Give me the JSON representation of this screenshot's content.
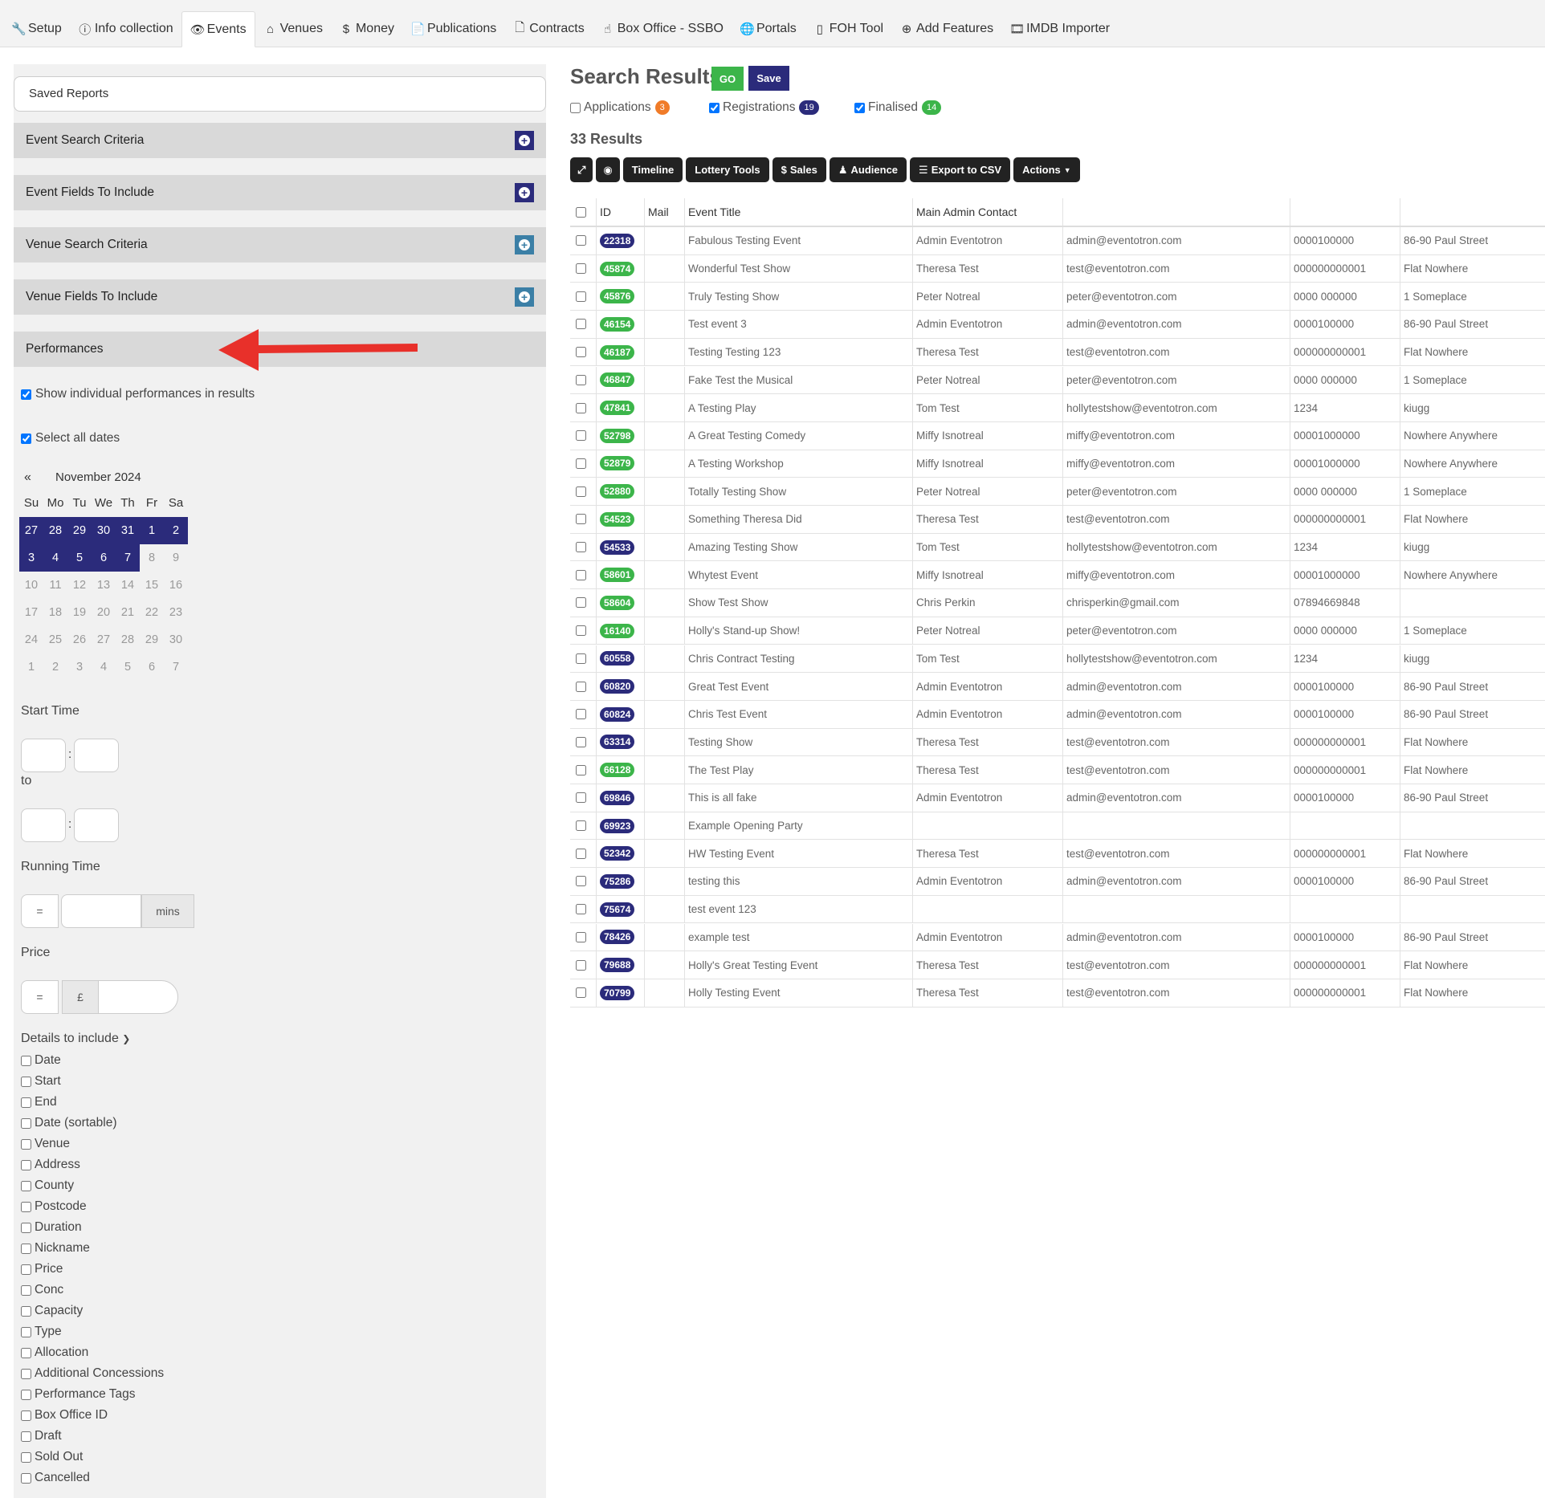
{
  "nav": {
    "tabs": [
      {
        "label": "Setup",
        "icon": "wrench-icon"
      },
      {
        "label": "Info collection",
        "icon": "info-icon"
      },
      {
        "label": "Events",
        "icon": "eye-icon"
      },
      {
        "label": "Venues",
        "icon": "home-icon"
      },
      {
        "label": "Money",
        "icon": "dollar-icon"
      },
      {
        "label": "Publications",
        "icon": "documents-icon"
      },
      {
        "label": "Contracts",
        "icon": "file-icon"
      },
      {
        "label": "Box Office - SSBO",
        "icon": "hand-icon"
      },
      {
        "label": "Portals",
        "icon": "globe-icon"
      },
      {
        "label": "FOH Tool",
        "icon": "mobile-icon"
      },
      {
        "label": "Add Features",
        "icon": "plus-circle-icon"
      },
      {
        "label": "IMDB Importer",
        "icon": "film-icon"
      }
    ],
    "active": "Events"
  },
  "sidebar": {
    "saved_reports": "Saved Reports",
    "panels": [
      "Event Search Criteria",
      "Event Fields To Include",
      "Venue Search Criteria",
      "Venue Fields To Include"
    ],
    "performances_label": "Performances",
    "show_individual": "Show individual performances in results",
    "select_all_dates": "Select all dates",
    "calendar": {
      "prev": "«",
      "month": "November 2024",
      "days_of_week": [
        "Su",
        "Mo",
        "Tu",
        "We",
        "Th",
        "Fr",
        "Sa"
      ],
      "weeks": [
        [
          "27",
          "28",
          "29",
          "30",
          "31",
          "1",
          "2"
        ],
        [
          "3",
          "4",
          "5",
          "6",
          "7",
          "8",
          "9"
        ],
        [
          "10",
          "11",
          "12",
          "13",
          "14",
          "15",
          "16"
        ],
        [
          "17",
          "18",
          "19",
          "20",
          "21",
          "22",
          "23"
        ],
        [
          "24",
          "25",
          "26",
          "27",
          "28",
          "29",
          "30"
        ],
        [
          "1",
          "2",
          "3",
          "4",
          "5",
          "6",
          "7"
        ]
      ],
      "selected_count": 12
    },
    "start_time_label": "Start Time",
    "to_label": "to",
    "colon": ":",
    "running_time_label": "Running Time",
    "eq": "=",
    "mins": "mins",
    "price_label": "Price",
    "currency": "£",
    "details_label": "Details to include",
    "details": [
      "Date",
      "Start",
      "End",
      "Date (sortable)",
      "Venue",
      "Address",
      "County",
      "Postcode",
      "Duration",
      "Nickname",
      "Price",
      "Conc",
      "Capacity",
      "Type",
      "Allocation",
      "Additional Concessions",
      "Performance Tags",
      "Box Office ID",
      "Draft",
      "Sold Out",
      "Cancelled"
    ]
  },
  "main": {
    "title": "Search Results",
    "go_label": "GO",
    "save_label": "Save",
    "filters": [
      {
        "label": "Applications",
        "count": "3",
        "checked": false,
        "color": "orange"
      },
      {
        "label": "Registrations",
        "count": "19",
        "checked": true,
        "color": "navy"
      },
      {
        "label": "Finalised",
        "count": "14",
        "checked": true,
        "color": "green"
      }
    ],
    "results_count": "33 Results",
    "toolbar": [
      "Timeline",
      "Lottery Tools",
      "Sales",
      "Audience",
      "Export to CSV",
      "Actions"
    ],
    "columns": [
      "ID",
      "Mail",
      "Event Title",
      "Main Admin Contact"
    ],
    "rows": [
      {
        "id": "22318",
        "status": "navy",
        "title": "Fabulous Testing Event",
        "contact": "Admin Eventotron",
        "email": "admin@eventotron.com",
        "phone": "0000100000",
        "address": "86-90 Paul Street"
      },
      {
        "id": "45874",
        "status": "green",
        "title": "Wonderful Test Show",
        "contact": "Theresa Test",
        "email": "test@eventotron.com",
        "phone": "000000000001",
        "address": "Flat Nowhere"
      },
      {
        "id": "45876",
        "status": "green",
        "title": "Truly Testing Show",
        "contact": "Peter Notreal",
        "email": "peter@eventotron.com",
        "phone": "0000 000000",
        "address": "1 Someplace"
      },
      {
        "id": "46154",
        "status": "green",
        "title": "Test event 3",
        "contact": "Admin Eventotron",
        "email": "admin@eventotron.com",
        "phone": "0000100000",
        "address": "86-90 Paul Street"
      },
      {
        "id": "46187",
        "status": "green",
        "title": "Testing Testing 123",
        "contact": "Theresa Test",
        "email": "test@eventotron.com",
        "phone": "000000000001",
        "address": "Flat Nowhere"
      },
      {
        "id": "46847",
        "status": "green",
        "title": "Fake Test the Musical",
        "contact": "Peter Notreal",
        "email": "peter@eventotron.com",
        "phone": "0000 000000",
        "address": "1 Someplace"
      },
      {
        "id": "47841",
        "status": "green",
        "title": "A Testing Play",
        "contact": "Tom Test",
        "email": "hollytestshow@eventotron.com",
        "phone": "1234",
        "address": "kiugg"
      },
      {
        "id": "52798",
        "status": "green",
        "title": "A Great Testing Comedy",
        "contact": "Miffy Isnotreal",
        "email": "miffy@eventotron.com",
        "phone": "00001000000",
        "address": "Nowhere Anywhere"
      },
      {
        "id": "52879",
        "status": "green",
        "title": "A Testing Workshop",
        "contact": "Miffy Isnotreal",
        "email": "miffy@eventotron.com",
        "phone": "00001000000",
        "address": "Nowhere Anywhere"
      },
      {
        "id": "52880",
        "status": "green",
        "title": "Totally Testing Show",
        "contact": "Peter Notreal",
        "email": "peter@eventotron.com",
        "phone": "0000 000000",
        "address": "1 Someplace"
      },
      {
        "id": "54523",
        "status": "green",
        "title": "Something Theresa Did",
        "contact": "Theresa Test",
        "email": "test@eventotron.com",
        "phone": "000000000001",
        "address": "Flat Nowhere"
      },
      {
        "id": "54533",
        "status": "navy",
        "title": "Amazing Testing Show",
        "contact": "Tom Test",
        "email": "hollytestshow@eventotron.com",
        "phone": "1234",
        "address": "kiugg"
      },
      {
        "id": "58601",
        "status": "green",
        "title": "Whytest Event",
        "contact": "Miffy Isnotreal",
        "email": "miffy@eventotron.com",
        "phone": "00001000000",
        "address": "Nowhere Anywhere"
      },
      {
        "id": "58604",
        "status": "green",
        "title": "Show Test Show",
        "contact": "Chris Perkin",
        "email": "chrisperkin@gmail.com",
        "phone": "07894669848",
        "address": ""
      },
      {
        "id": "16140",
        "status": "green",
        "title": "Holly's Stand-up Show!",
        "contact": "Peter Notreal",
        "email": "peter@eventotron.com",
        "phone": "0000 000000",
        "address": "1 Someplace"
      },
      {
        "id": "60558",
        "status": "navy",
        "title": "Chris Contract Testing",
        "contact": "Tom Test",
        "email": "hollytestshow@eventotron.com",
        "phone": "1234",
        "address": "kiugg"
      },
      {
        "id": "60820",
        "status": "navy",
        "title": "Great Test Event",
        "contact": "Admin Eventotron",
        "email": "admin@eventotron.com",
        "phone": "0000100000",
        "address": "86-90 Paul Street"
      },
      {
        "id": "60824",
        "status": "navy",
        "title": "Chris Test Event",
        "contact": "Admin Eventotron",
        "email": "admin@eventotron.com",
        "phone": "0000100000",
        "address": "86-90 Paul Street"
      },
      {
        "id": "63314",
        "status": "navy",
        "title": "Testing Show",
        "contact": "Theresa Test",
        "email": "test@eventotron.com",
        "phone": "000000000001",
        "address": "Flat Nowhere"
      },
      {
        "id": "66128",
        "status": "green",
        "title": "The Test Play",
        "contact": "Theresa Test",
        "email": "test@eventotron.com",
        "phone": "000000000001",
        "address": "Flat Nowhere"
      },
      {
        "id": "69846",
        "status": "navy",
        "title": "This is all fake",
        "contact": "Admin Eventotron",
        "email": "admin@eventotron.com",
        "phone": "0000100000",
        "address": "86-90 Paul Street"
      },
      {
        "id": "69923",
        "status": "navy",
        "title": "Example Opening Party",
        "contact": "",
        "email": "",
        "phone": "",
        "address": ""
      },
      {
        "id": "52342",
        "status": "navy",
        "title": "HW Testing Event",
        "contact": "Theresa Test",
        "email": "test@eventotron.com",
        "phone": "000000000001",
        "address": "Flat Nowhere"
      },
      {
        "id": "75286",
        "status": "navy",
        "title": "testing this",
        "contact": "Admin Eventotron",
        "email": "admin@eventotron.com",
        "phone": "0000100000",
        "address": "86-90 Paul Street"
      },
      {
        "id": "75674",
        "status": "navy",
        "title": "test event 123",
        "contact": "",
        "email": "",
        "phone": "",
        "address": ""
      },
      {
        "id": "78426",
        "status": "navy",
        "title": "example test",
        "contact": "Admin Eventotron",
        "email": "admin@eventotron.com",
        "phone": "0000100000",
        "address": "86-90 Paul Street"
      },
      {
        "id": "79688",
        "status": "navy",
        "title": "Holly's Great Testing Event",
        "contact": "Theresa Test",
        "email": "test@eventotron.com",
        "phone": "000000000001",
        "address": "Flat Nowhere"
      },
      {
        "id": "70799",
        "status": "navy",
        "title": "Holly Testing Event",
        "contact": "Theresa Test",
        "email": "test@eventotron.com",
        "phone": "000000000001",
        "address": "Flat Nowhere"
      }
    ]
  },
  "colors": {
    "navy": "#2b2b7b",
    "green": "#3cb54a",
    "orange": "#f07b28",
    "annotation_arrow": "#e8302a"
  }
}
